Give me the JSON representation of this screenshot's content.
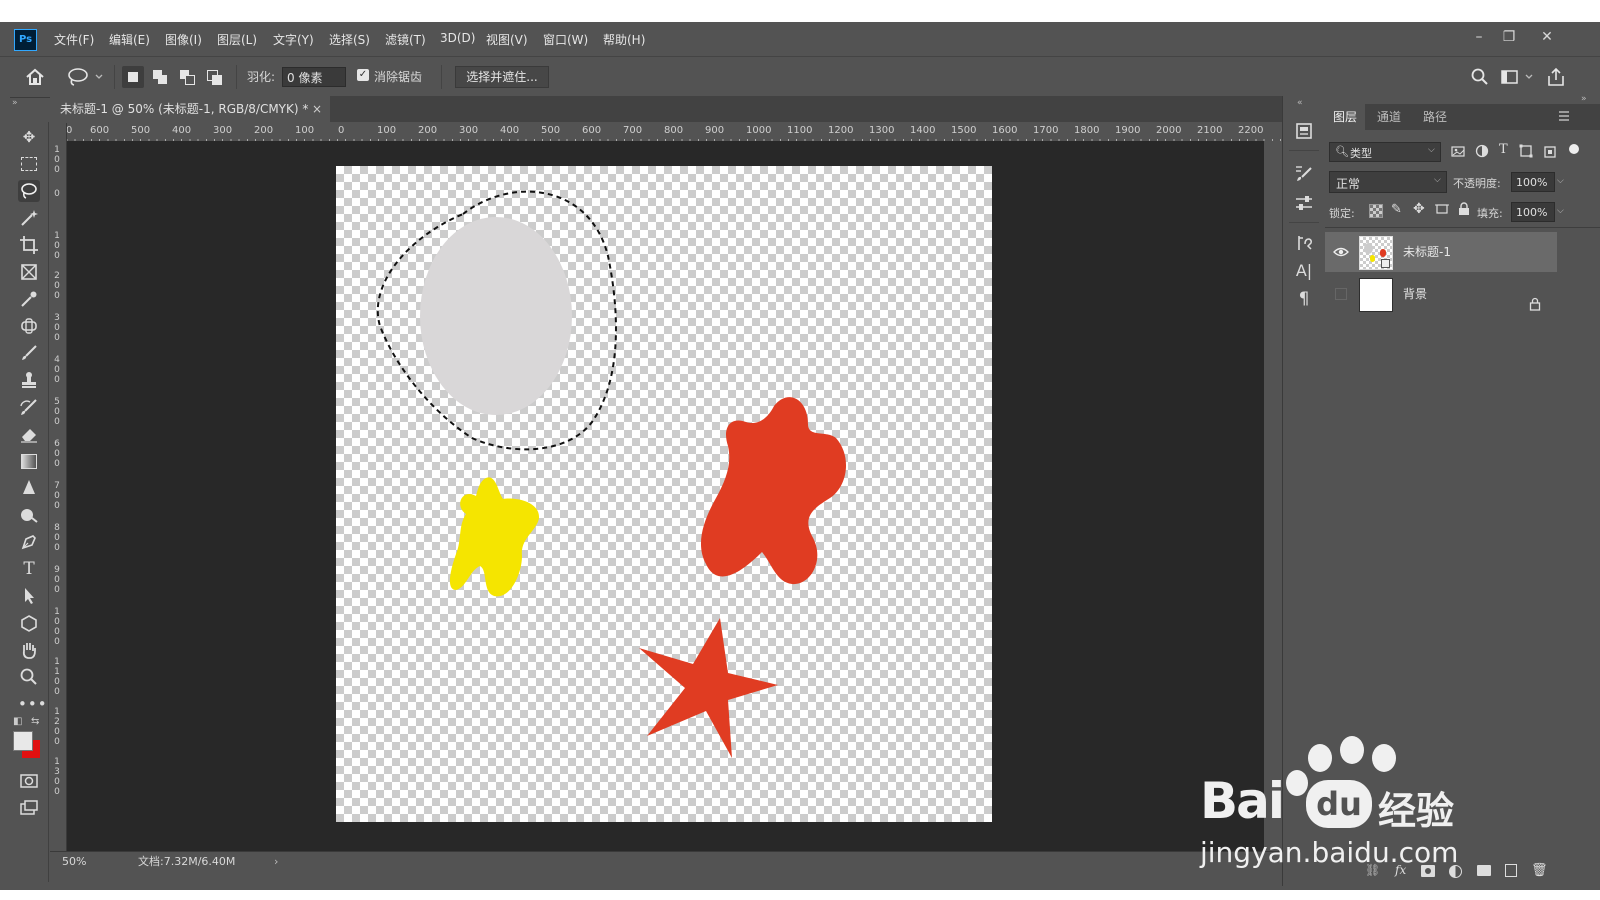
{
  "app": {
    "logo": "Ps"
  },
  "menu": [
    "文件(F)",
    "编辑(E)",
    "图像(I)",
    "图层(L)",
    "文字(Y)",
    "选择(S)",
    "滤镜(T)",
    "3D(D)",
    "视图(V)",
    "窗口(W)",
    "帮助(H)"
  ],
  "window_controls": {
    "minimize": "–",
    "restore": "❐",
    "close": "✕"
  },
  "options_bar": {
    "feather_label": "羽化:",
    "feather_value": "0 像素",
    "antialias_label": "消除锯齿",
    "antialias_checked": true,
    "select_mask_button": "选择并遮住..."
  },
  "document": {
    "tab_title": "未标题-1 @ 50% (未标题-1, RGB/8/CMYK) *",
    "tab_close": "×",
    "zoom": "50%",
    "doc_info": "文档:7.32M/6.40M",
    "status_arrow": "›"
  },
  "ruler": {
    "horizontal": [
      "0",
      "600",
      "500",
      "400",
      "300",
      "200",
      "100",
      "0",
      "100",
      "200",
      "300",
      "400",
      "500",
      "600",
      "700",
      "800",
      "900",
      "1000",
      "1100",
      "1200",
      "1300",
      "1400",
      "1500",
      "1600",
      "1700",
      "1800",
      "1900",
      "2000",
      "2100",
      "2200"
    ],
    "vertical": [
      "1\n0\n0",
      "0",
      "1\n0\n0",
      "2\n0\n0",
      "3\n0\n0",
      "4\n0\n0",
      "5\n0\n0",
      "6\n0\n0",
      "7\n0\n0",
      "8\n0\n0",
      "9\n0\n0",
      "1\n0\n0\n0",
      "1\n1\n0\n0",
      "1\n2\n0\n0",
      "1\n3\n0\n0"
    ]
  },
  "canvas_shapes": {
    "ellipse_color": "#d9d7d8",
    "yellow_blob_color": "#f5e500",
    "red_color": "#e03c22"
  },
  "tools": [
    "move-tool",
    "marquee-tool",
    "lasso-tool",
    "magic-wand-tool",
    "crop-tool",
    "frame-tool",
    "eyedropper-tool",
    "healing-brush-tool",
    "brush-tool",
    "clone-stamp-tool",
    "history-brush-tool",
    "eraser-tool",
    "gradient-tool",
    "blur-tool",
    "dodge-tool",
    "pen-tool",
    "type-tool",
    "path-selection-tool",
    "shape-tool",
    "hand-tool",
    "zoom-tool",
    "edit-toolbar"
  ],
  "colors": {
    "foreground": "#e8e8e8",
    "background": "#e01010"
  },
  "layers_panel": {
    "tabs": [
      "图层",
      "通道",
      "路径"
    ],
    "active_tab": 0,
    "filter_kind": "类型",
    "blend_mode": "正常",
    "opacity_label": "不透明度:",
    "opacity_value": "100%",
    "lock_label": "锁定:",
    "fill_label": "填充:",
    "fill_value": "100%",
    "layers": [
      {
        "name": "未标题-1",
        "visible": true,
        "selected": true
      },
      {
        "name": "背景",
        "visible": false,
        "locked": true
      }
    ]
  },
  "watermark": {
    "brand": "Bai",
    "du": "du",
    "jy": "经验",
    "url": "jingyan.baidu.com"
  }
}
